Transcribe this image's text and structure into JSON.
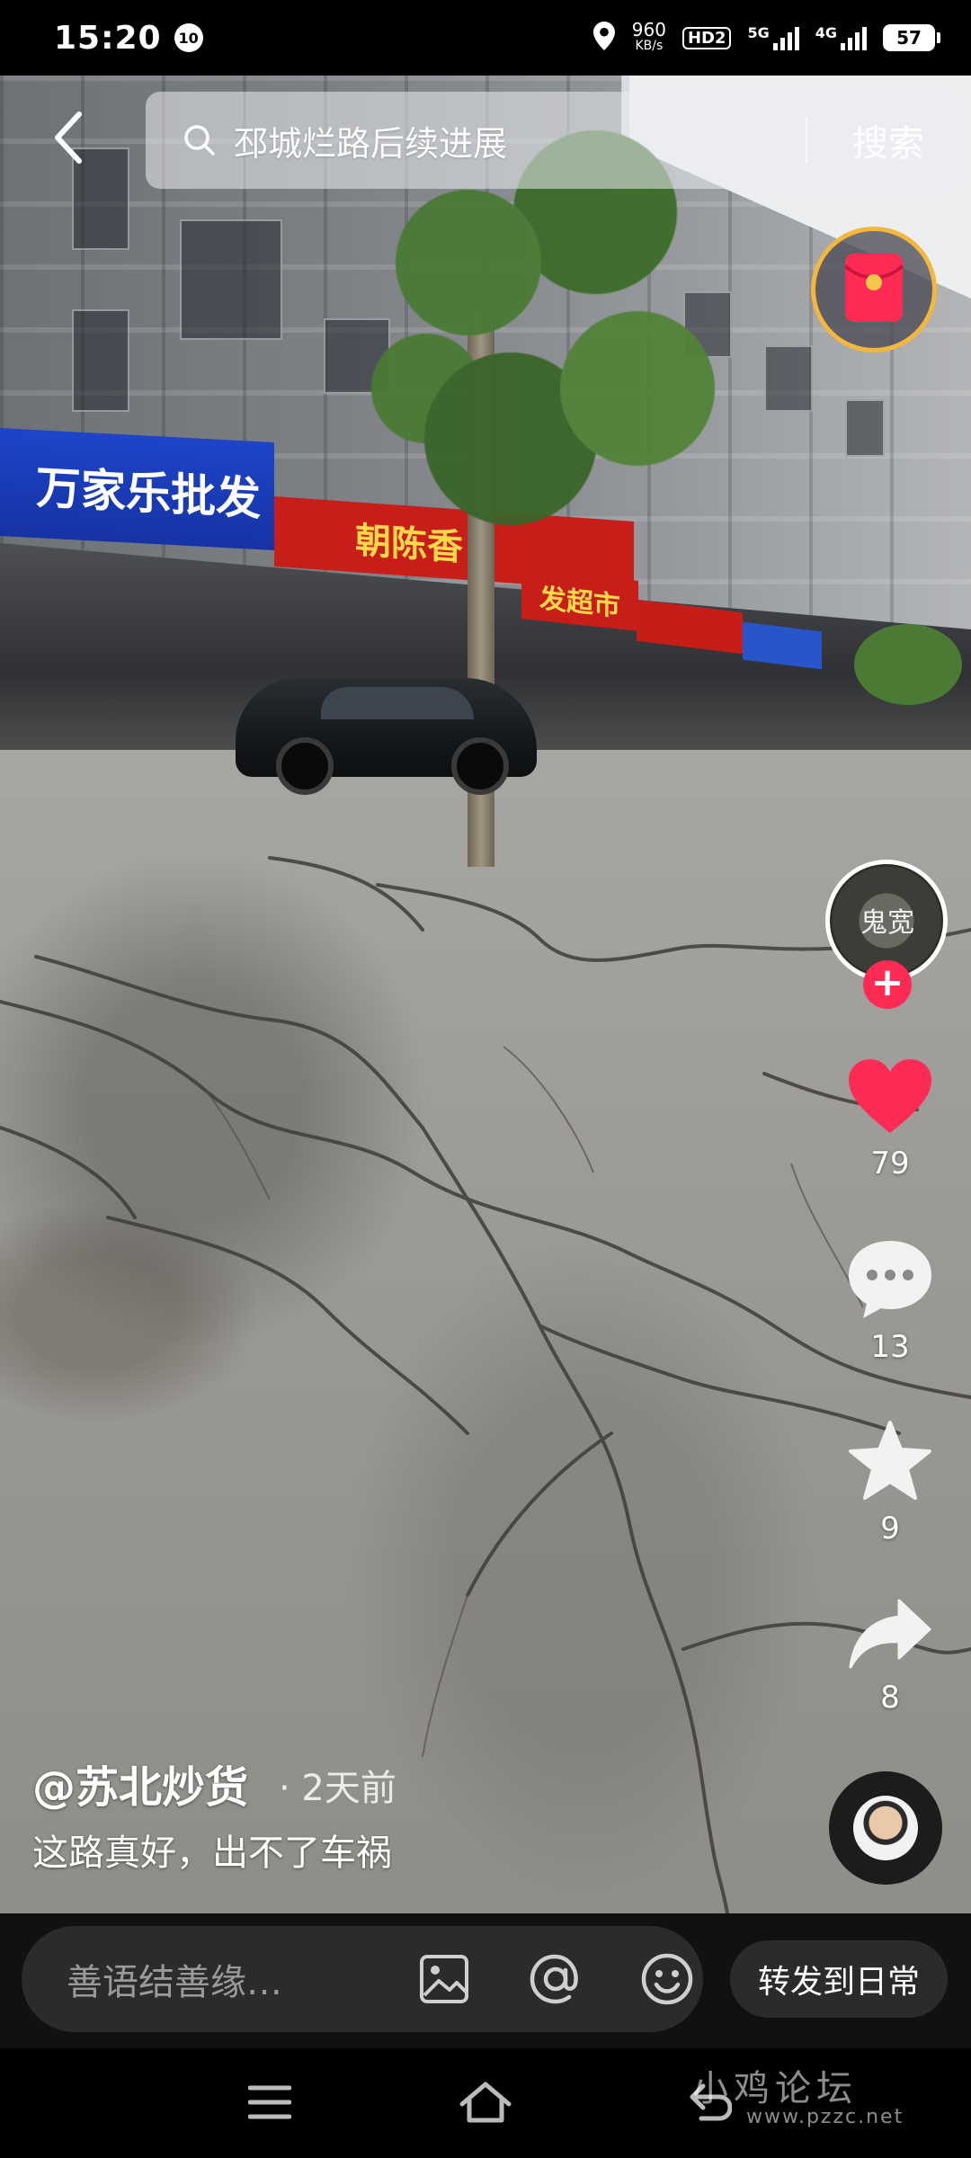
{
  "status_bar": {
    "time": "15:20",
    "notification_badge": "10",
    "net_speed_value": "960",
    "net_speed_unit": "KB/s",
    "hd_tag": "HD2",
    "network_5g": "5G",
    "network_4g": "4G",
    "battery": "57"
  },
  "search": {
    "query": "邳城烂路后续进展",
    "button_label": "搜索"
  },
  "video_scene": {
    "sign_blue_text": "万家乐批发",
    "sign_red_text": "朝陈香",
    "sign_red2_text": "发超市"
  },
  "creator": {
    "avatar_text": "鬼宽"
  },
  "actions": {
    "likes": "79",
    "comments": "13",
    "favorites": "9",
    "shares": "8"
  },
  "post": {
    "author": "@苏北炒货",
    "time": "· 2天前",
    "caption": "这路真好，出不了车祸"
  },
  "comment_bar": {
    "placeholder": "善语结善缘…",
    "share_daily_label": "转发到日常"
  },
  "watermark": {
    "text": "小鸡论坛",
    "url": "www.pzzc.net"
  },
  "colors": {
    "like": "#fe2c55",
    "follow_plus": "#fe2c55",
    "red_packet_ring": "#f2b73b"
  }
}
